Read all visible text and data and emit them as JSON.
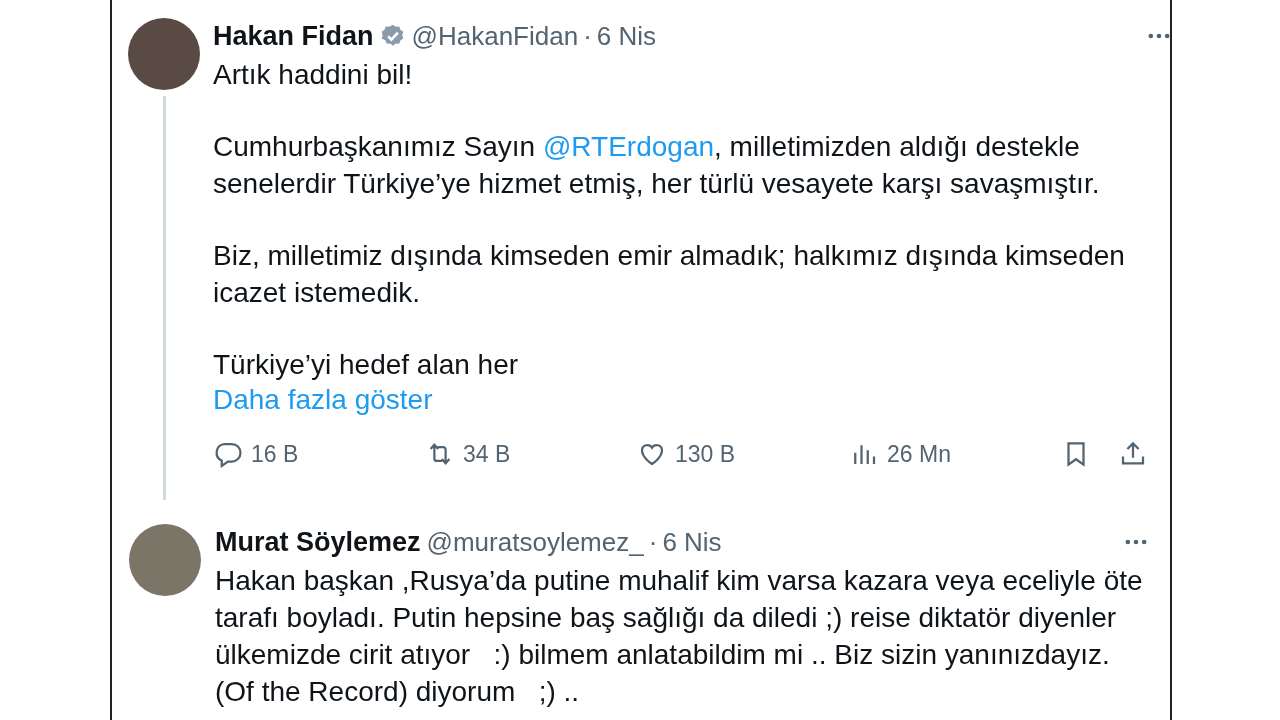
{
  "tweets": [
    {
      "name": "Hakan Fidan",
      "verified": true,
      "handle": "@HakanFidan",
      "separator": "·",
      "date": "6 Nis",
      "thread_line": true,
      "paragraphs": [
        [
          {
            "kind": "text",
            "text": "Artık haddini bil!"
          }
        ],
        [
          {
            "kind": "text",
            "text": "Cumhurbaşkanımız Sayın "
          },
          {
            "kind": "mention",
            "text": "@RTErdogan"
          },
          {
            "kind": "text",
            "text": ", milletimizden aldığı destekle senelerdir Türkiye’ye hizmet etmiş, her türlü vesayete karşı savaşmıştır."
          }
        ],
        [
          {
            "kind": "text",
            "text": "Biz, milletimiz dışında kimseden emir almadık; halkımız dışında kimseden icazet istemedik."
          }
        ],
        [
          {
            "kind": "text",
            "text": "Türkiye’yi hedef alan her"
          }
        ]
      ],
      "show_more": "Daha fazla göster",
      "actions": [
        {
          "kind": "reply",
          "count": "16 B"
        },
        {
          "kind": "repost",
          "count": "34 B"
        },
        {
          "kind": "like",
          "count": "130 B"
        },
        {
          "kind": "views",
          "count": "26 Mn"
        },
        {
          "kind": "bookmark"
        },
        {
          "kind": "share"
        }
      ]
    },
    {
      "name": "Murat Söylemez",
      "verified": false,
      "handle": "@muratsoylemez_",
      "separator": "·",
      "date": "6 Nis",
      "thread_line": false,
      "paragraphs": [
        [
          {
            "kind": "text",
            "text": "Hakan başkan ,Rusya’da putine muhalif kim varsa kazara veya eceliyle öte tarafı boyladı. Putin hepsine baş sağlığı da diledi ;) reise diktatör diyenler ülkemizde cirit atıyor   :) bilmem anlatabildim mi .. Biz sizin yanınızdayız. (Of the Record) diyorum   ;) .."
          }
        ]
      ]
    }
  ]
}
